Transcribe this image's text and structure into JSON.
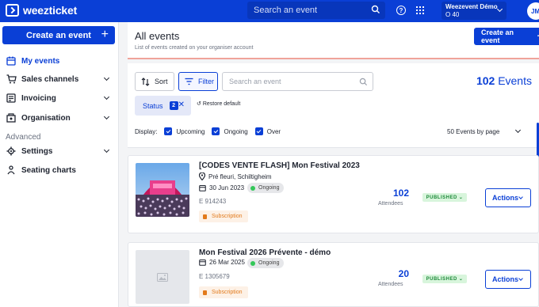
{
  "topbar": {
    "brand": "weezticket",
    "search_placeholder": "Search an event",
    "org_name": "Weezevent Démo",
    "org_id": "O 40",
    "avatar_initials": "JM"
  },
  "sidebar": {
    "create_label": "Create an event",
    "items": [
      {
        "label": "My events",
        "icon": "calendar-icon",
        "active": true
      },
      {
        "label": "Sales channels",
        "icon": "cart-icon"
      },
      {
        "label": "Invoicing",
        "icon": "invoice-icon"
      },
      {
        "label": "Organisation",
        "icon": "building-icon"
      }
    ],
    "section_label": "Advanced",
    "advanced_items": [
      {
        "label": "Settings",
        "icon": "gear-icon"
      },
      {
        "label": "Seating charts",
        "icon": "seating-icon"
      }
    ]
  },
  "header": {
    "title": "All events",
    "subtitle": "List of events created on your organiser account",
    "create_label": "Create an event"
  },
  "filters": {
    "sort_label": "Sort",
    "filter_label": "Filter",
    "search_placeholder": "Search an event",
    "total_count": "102",
    "total_label": "Events",
    "status_chip_label": "Status",
    "status_chip_count": "2",
    "restore_label": "Restore default",
    "display_label": "Display:",
    "display_options": [
      "Upcoming",
      "Ongoing",
      "Over"
    ],
    "per_page": "50 Events by page"
  },
  "events": [
    {
      "title": "[CODES VENTE FLASH] Mon Festival 2023",
      "location": "Pré fleuri, Schiltigheim",
      "date": "30 Jun 2023",
      "state": "Ongoing",
      "id": "E 914243",
      "tag": "Subscription",
      "attendees": "102",
      "attendees_label": "Attendees",
      "publish_status": "PUBLISHED",
      "actions_label": "Actions"
    },
    {
      "title": "Mon Festival 2026 Prévente - démo",
      "date": "26 Mar 2025",
      "state": "Ongoing",
      "id": "E 1305679",
      "tag": "Subscription",
      "attendees": "20",
      "attendees_label": "Attendees",
      "publish_status": "PUBLISHED",
      "actions_label": "Actions"
    }
  ]
}
